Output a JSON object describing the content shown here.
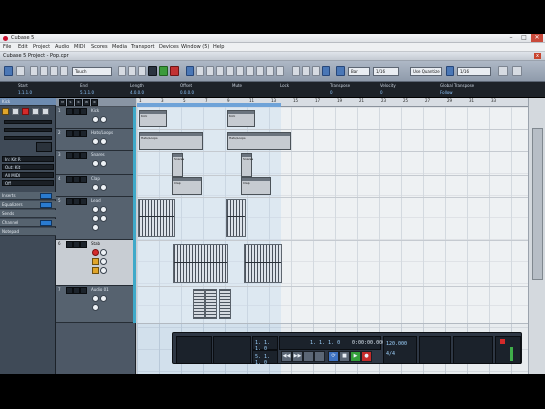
{
  "window": {
    "title": "Cubase 5",
    "min": "–",
    "max": "□",
    "close": "✕"
  },
  "menu": [
    "File",
    "Edit",
    "Project",
    "Audio",
    "MIDI",
    "Scores",
    "Media",
    "Transport",
    "Devices",
    "Window (5)",
    "Help"
  ],
  "project": {
    "title": "Cubase 5 Project - Pop.cpr",
    "close": "x"
  },
  "toolbar": {
    "mode_field": "Touch",
    "grid_field": "Bar",
    "quantize_field": "1/16",
    "snap_field": "1/16",
    "grid_type": "Use Quantize"
  },
  "infoline": {
    "labels": [
      "Start",
      "End",
      "Length",
      "Offset",
      "Mute",
      "Lock",
      "Transpose",
      "Velocity",
      "Global Transpose"
    ],
    "values": [
      "1.1.1.0",
      "5.1.1.0",
      "4.0.0.0",
      "0.0.0.0",
      "",
      "",
      "0",
      "0",
      "Follow"
    ]
  },
  "inspector": {
    "rows": [
      "Kick",
      "Inserts",
      "Equalizers",
      "Sends",
      "Channel",
      "Notepad"
    ],
    "fields": [
      "In: Kit R",
      "Out: Kit",
      "All MIDI",
      "Off"
    ]
  },
  "ruler": {
    "marks": [
      "1",
      "3",
      "5",
      "7",
      "9",
      "11",
      "13",
      "15",
      "17",
      "19",
      "21",
      "23",
      "25",
      "27",
      "29",
      "31",
      "33"
    ]
  },
  "tracks": [
    {
      "num": "1",
      "name": "Kick"
    },
    {
      "num": "2",
      "name": "Hats/Loops"
    },
    {
      "num": "3",
      "name": "Snares"
    },
    {
      "num": "4",
      "name": "Clap"
    },
    {
      "num": "5",
      "name": "Lead"
    },
    {
      "num": "6",
      "name": "Stab"
    },
    {
      "num": "7",
      "name": "Audio 01"
    }
  ],
  "parts": {
    "kick1": "Kick",
    "kick2": "Kick",
    "hats1": "Hats/Loops",
    "hats2": "Hats/Loops",
    "snare1": "Snares",
    "snare2": "Snares",
    "clap1": "Clap",
    "clap2": "Clap"
  },
  "transport": {
    "position": "1. 1. 1. 0",
    "time": "0:00:00.000",
    "left": "1. 1. 1. 0",
    "right": "5. 1. 1. 0",
    "tempo": "120.000",
    "sig": "4/4",
    "rewind": "◀◀",
    "forward": "▶▶",
    "stop": "■",
    "play": "▶",
    "record": "●",
    "cycle": "⟳"
  }
}
